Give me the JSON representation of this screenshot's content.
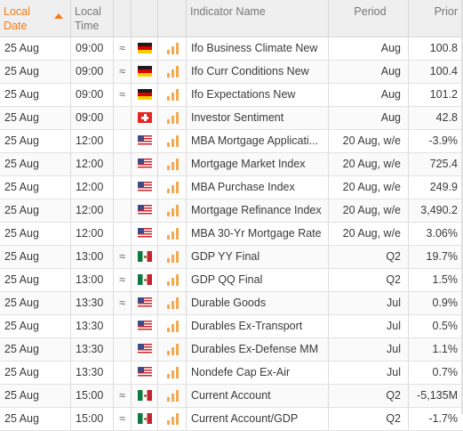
{
  "header": {
    "date_label": "Local Date",
    "time_label": "Local Time",
    "name_label": "Indicator Name",
    "period_label": "Period",
    "prior_label": "Prior"
  },
  "rows": [
    {
      "date": "25 Aug",
      "time": "09:00",
      "approx": "≈",
      "country": "de",
      "impact": 3,
      "name": "Ifo Business Climate New",
      "period": "Aug",
      "prior": "100.8"
    },
    {
      "date": "25 Aug",
      "time": "09:00",
      "approx": "≈",
      "country": "de",
      "impact": 3,
      "name": "Ifo Curr Conditions New",
      "period": "Aug",
      "prior": "100.4"
    },
    {
      "date": "25 Aug",
      "time": "09:00",
      "approx": "≈",
      "country": "de",
      "impact": 3,
      "name": "Ifo Expectations New",
      "period": "Aug",
      "prior": "101.2"
    },
    {
      "date": "25 Aug",
      "time": "09:00",
      "approx": "",
      "country": "ch",
      "impact": 3,
      "name": "Investor Sentiment",
      "period": "Aug",
      "prior": "42.8"
    },
    {
      "date": "25 Aug",
      "time": "12:00",
      "approx": "",
      "country": "us",
      "impact": 3,
      "name": "MBA Mortgage Applicati...",
      "period": "20 Aug, w/e",
      "prior": "-3.9%"
    },
    {
      "date": "25 Aug",
      "time": "12:00",
      "approx": "",
      "country": "us",
      "impact": 3,
      "name": "Mortgage Market Index",
      "period": "20 Aug, w/e",
      "prior": "725.4"
    },
    {
      "date": "25 Aug",
      "time": "12:00",
      "approx": "",
      "country": "us",
      "impact": 3,
      "name": "MBA Purchase Index",
      "period": "20 Aug, w/e",
      "prior": "249.9"
    },
    {
      "date": "25 Aug",
      "time": "12:00",
      "approx": "",
      "country": "us",
      "impact": 3,
      "name": "Mortgage Refinance Index",
      "period": "20 Aug, w/e",
      "prior": "3,490.2"
    },
    {
      "date": "25 Aug",
      "time": "12:00",
      "approx": "",
      "country": "us",
      "impact": 3,
      "name": "MBA 30-Yr Mortgage Rate",
      "period": "20 Aug, w/e",
      "prior": "3.06%"
    },
    {
      "date": "25 Aug",
      "time": "13:00",
      "approx": "≈",
      "country": "mx",
      "impact": 3,
      "name": "GDP YY Final",
      "period": "Q2",
      "prior": "19.7%"
    },
    {
      "date": "25 Aug",
      "time": "13:00",
      "approx": "≈",
      "country": "mx",
      "impact": 3,
      "name": "GDP QQ Final",
      "period": "Q2",
      "prior": "1.5%"
    },
    {
      "date": "25 Aug",
      "time": "13:30",
      "approx": "≈",
      "country": "us",
      "impact": 3,
      "name": "Durable Goods",
      "period": "Jul",
      "prior": "0.9%"
    },
    {
      "date": "25 Aug",
      "time": "13:30",
      "approx": "",
      "country": "us",
      "impact": 3,
      "name": "Durables Ex-Transport",
      "period": "Jul",
      "prior": "0.5%"
    },
    {
      "date": "25 Aug",
      "time": "13:30",
      "approx": "",
      "country": "us",
      "impact": 3,
      "name": "Durables Ex-Defense MM",
      "period": "Jul",
      "prior": "1.1%"
    },
    {
      "date": "25 Aug",
      "time": "13:30",
      "approx": "",
      "country": "us",
      "impact": 3,
      "name": "Nondefe Cap Ex-Air",
      "period": "Jul",
      "prior": "0.7%"
    },
    {
      "date": "25 Aug",
      "time": "15:00",
      "approx": "≈",
      "country": "mx",
      "impact": 3,
      "name": "Current Account",
      "period": "Q2",
      "prior": "-5,135M"
    },
    {
      "date": "25 Aug",
      "time": "15:00",
      "approx": "≈",
      "country": "mx",
      "impact": 3,
      "name": "Current Account/GDP",
      "period": "Q2",
      "prior": "-1.7%"
    }
  ],
  "colors": {
    "accent": "#f07b16",
    "impact_bar": "#f4a94e",
    "header_bg": "#efefef"
  },
  "icons": {
    "sort": "sort-asc-icon",
    "approx": "approximate-time-icon",
    "impact": "impact-bars-icon"
  }
}
